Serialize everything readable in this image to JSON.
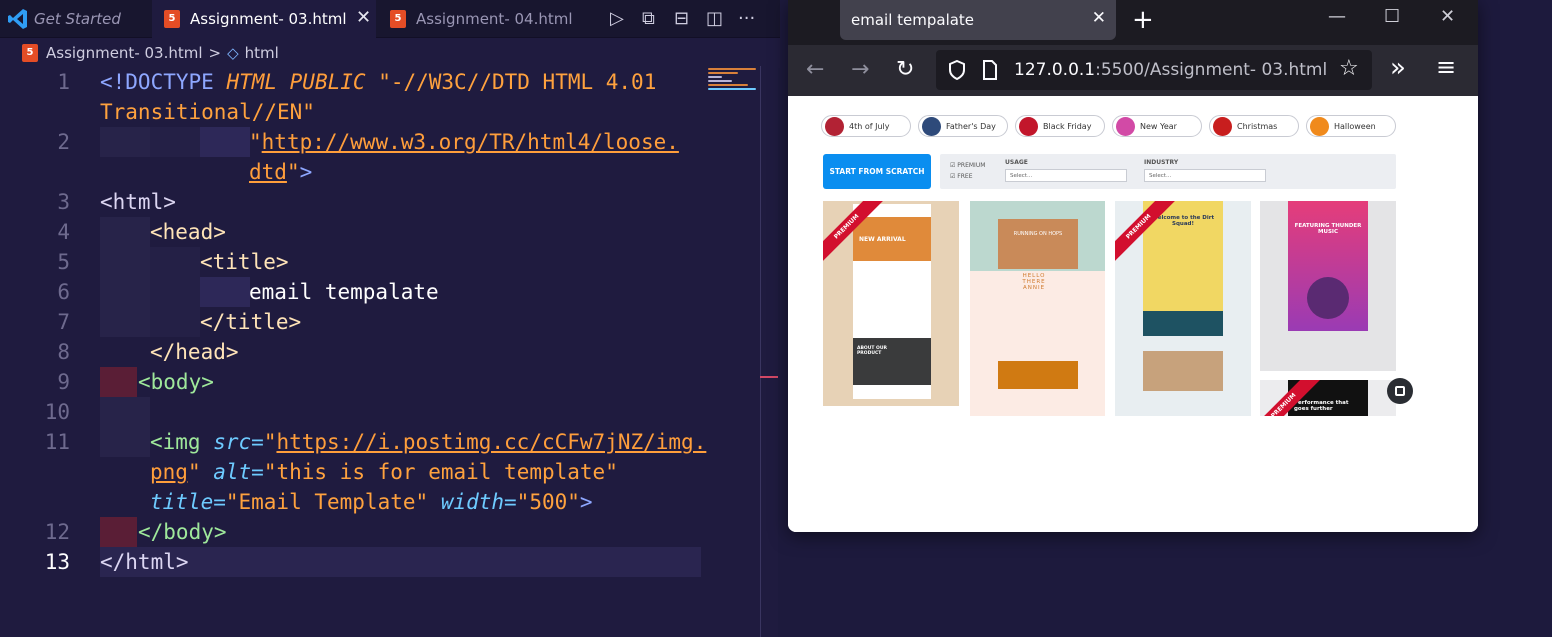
{
  "tabs": [
    {
      "label": "Get Started"
    },
    {
      "label": "Assignment- 03.html"
    },
    {
      "label": "Assignment- 04.html"
    }
  ],
  "tab_actions": {
    "run": "▷",
    "split": "⧉",
    "layout": "⊟",
    "editor_split": "◫",
    "more": "···"
  },
  "breadcrumb": {
    "file": "Assignment- 03.html",
    "separator": ">",
    "element": "html"
  },
  "code": {
    "line_numbers": [
      "1",
      "2",
      "3",
      "4",
      "5",
      "6",
      "7",
      "8",
      "9",
      "10",
      "11",
      "12",
      "13"
    ],
    "l1a": "<!DOCTYPE",
    "l1b": "HTML PUBLIC",
    "l1c": "\"-//W3C//DTD HTML 4.01",
    "l1d": "Transitional//EN\"",
    "l2a": "\"",
    "l2b": "http://www.w3.org/TR/html4/loose.",
    "l2c": "dtd",
    "l2d": "\"",
    "l2e": ">",
    "l3": "<html>",
    "l4": "<head>",
    "l5": "<title>",
    "l6": "email tempalate",
    "l7": "</title>",
    "l8": "</head>",
    "l9": "<body>",
    "l11a": "<img",
    "l11b": "src=",
    "l11c": "\"",
    "l11d": "https://i.postimg.cc/cCFw7jNZ/img.",
    "l11e": "png",
    "l11f": "\"",
    "l11g": "alt=",
    "l11h": "\"this is for email template\"",
    "l11i": "title=",
    "l11j": "\"Email Template\"",
    "l11k": "width=",
    "l11l": "\"500\"",
    "l11m": ">",
    "l12": "</body>",
    "l13": "</html>"
  },
  "browser": {
    "tab_title": "email tempalate",
    "tab_close": "✕",
    "new_tab": "+",
    "minimize": "—",
    "maximize": "☐",
    "close": "✕",
    "back": "←",
    "forward": "→",
    "reload": "↻",
    "url_host": "127.0.0.1",
    "url_rest": ":5500/Assignment- 03.html",
    "bookmark": "☆",
    "overflow": "»",
    "menu": "≡"
  },
  "page": {
    "categories": [
      {
        "label": "4th of July",
        "color": "#b22234"
      },
      {
        "label": "Father's Day",
        "color": "#2e4a7a"
      },
      {
        "label": "Black Friday",
        "color": "#c2162b"
      },
      {
        "label": "New Year",
        "color": "#d24aa6"
      },
      {
        "label": "Christmas",
        "color": "#c81e1e"
      },
      {
        "label": "Halloween",
        "color": "#f08a1c"
      }
    ],
    "start_button": "START FROM SCRATCH",
    "premium_label": "PREMIUM",
    "free_label": "FREE",
    "usage_label": "USAGE",
    "industry_label": "INDUSTRY",
    "select_placeholder": "Select...",
    "ribbon": "PREMIUM",
    "card1": {
      "title": "NEW ARRIVAL",
      "section": "ABOUT OUR PRODUCT"
    },
    "card2": {
      "title": "RUNNING ON HOPS",
      "subtitle": "HELLO THERE ANNIE"
    },
    "card3": {
      "title": "Welcome to the Dirt Squad!"
    },
    "card4": {
      "title": "FEATURING THUNDER MUSIC"
    },
    "card5": {
      "title": "Performance that goes further"
    }
  }
}
